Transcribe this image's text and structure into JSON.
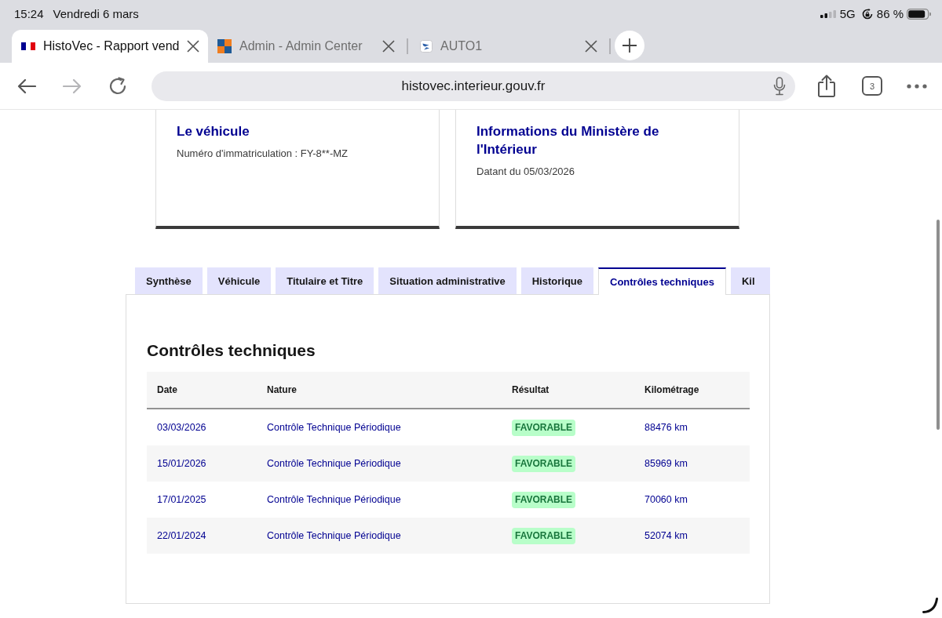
{
  "status_bar": {
    "time": "15:24",
    "date": "Vendredi 6 mars",
    "network": "5G",
    "battery": "86 %"
  },
  "browser_tabs": [
    {
      "title": "HistoVec - Rapport vend",
      "selected": true
    },
    {
      "title": "Admin - Admin Center",
      "selected": false
    },
    {
      "title": "AUTO1",
      "selected": false
    }
  ],
  "toolbar": {
    "back_disabled": false,
    "forward_disabled": true,
    "url": "histovec.interieur.gouv.fr",
    "tab_count": "3"
  },
  "cards": [
    {
      "title": "Le véhicule",
      "text": "Numéro d'immatriculation : FY-8**-MZ"
    },
    {
      "title": "Informations du Ministère de l'Intérieur",
      "text": "Datant du 05/03/2026"
    }
  ],
  "tabs": [
    {
      "label": "Synthèse",
      "selected": false
    },
    {
      "label": "Véhicule",
      "selected": false
    },
    {
      "label": "Titulaire et Titre",
      "selected": false
    },
    {
      "label": "Situation administrative",
      "selected": false
    },
    {
      "label": "Historique",
      "selected": false
    },
    {
      "label": "Contrôles techniques",
      "selected": true
    },
    {
      "label": "Kil",
      "selected": false
    }
  ],
  "panel": {
    "title": "Contrôles techniques",
    "table": {
      "columns": [
        "Date",
        "Nature",
        "Résultat",
        "Kilométrage"
      ],
      "rows": [
        {
          "date": "03/03/2026",
          "nature": "Contrôle Technique Périodique",
          "result": "FAVORABLE",
          "mileage": "88476 km"
        },
        {
          "date": "15/01/2026",
          "nature": "Contrôle Technique Périodique",
          "result": "FAVORABLE",
          "mileage": "85969 km"
        },
        {
          "date": "17/01/2025",
          "nature": "Contrôle Technique Périodique",
          "result": "FAVORABLE",
          "mileage": "70060 km"
        },
        {
          "date": "22/01/2024",
          "nature": "Contrôle Technique Périodique",
          "result": "FAVORABLE",
          "mileage": "52074 km"
        }
      ]
    }
  }
}
